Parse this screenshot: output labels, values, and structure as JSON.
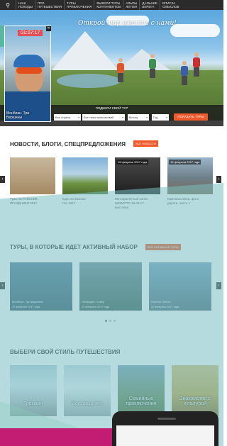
{
  "topnav": {
    "items": [
      "Наш\nпоходы",
      "Про\nпутешествия",
      "Туры\nприключения",
      "Выбери туры\nконтинентов",
      "Альпы\nлетом",
      "Дальние\nберега",
      "Вписка\nсмыслов"
    ]
  },
  "hero": {
    "slogan": "Открой мир вместе с нами!"
  },
  "search": {
    "title": "Подбери свой тур",
    "fields": [
      "Все страны",
      "Все типы путешествий",
      "Месяц",
      "Год"
    ],
    "button": "Показать туры"
  },
  "video": {
    "timer": "01:07:17",
    "caption": "Монблан. Три\nВершины"
  },
  "news": {
    "title": "Новости, блоги, спецпредложения",
    "badge": "Все новости",
    "cards": [
      {
        "date": "",
        "text": "Туры на РАЙСКИЕ\nПРАЗДНИКИ 2017"
      },
      {
        "date": "",
        "text": "Курс на Халхин-\nГол 2017"
      },
      {
        "date": "15 февраля 2017 года",
        "text": "Мотоциклетный салон\nIMOMOTO 15.04.17 -\nвыставка"
      },
      {
        "date": "15 февраля 2017 года",
        "text": "Камчатка-2016, фото\nдороги, часть 1"
      }
    ]
  },
  "tours": {
    "title": "Туры, в которые идет активный набор",
    "badge": "Все активные туры",
    "cards": [
      {
        "caption": "Монблан. Три вершины",
        "date": "22 февраля 2017 года"
      },
      {
        "caption": "Исландия. Север",
        "date": "22 февраля 2017 года"
      },
      {
        "caption": "Япония. Весна",
        "date": "22 февраля 2017 года"
      }
    ]
  },
  "styles": {
    "title": "Выбери свой стиль путешествия",
    "cards": [
      "Треккинг",
      "Восхождения",
      "Семейные\nприключения",
      "Знакомство с\nкультурой"
    ]
  }
}
